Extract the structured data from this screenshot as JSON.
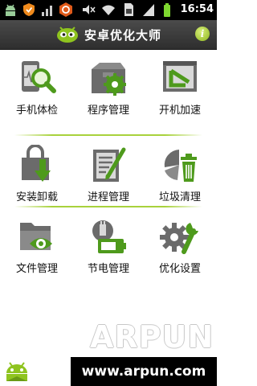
{
  "status": {
    "time": "16:54",
    "icons": [
      "android-debug-icon",
      "shield-icon",
      "signal-icon",
      "hexagon-app-icon",
      "mute-icon",
      "wifi-icon",
      "sim-icon",
      "cell-signal-icon",
      "battery-icon"
    ]
  },
  "header": {
    "title": "安卓优化大师",
    "info_label": "i"
  },
  "menu": {
    "items": [
      {
        "label": "手机体检",
        "icon": "phone-checkup-icon"
      },
      {
        "label": "程序管理",
        "icon": "app-manager-icon"
      },
      {
        "label": "开机加速",
        "icon": "boot-speed-icon"
      },
      {
        "label": "安装卸载",
        "icon": "install-uninstall-icon"
      },
      {
        "label": "进程管理",
        "icon": "process-manager-icon"
      },
      {
        "label": "垃圾清理",
        "icon": "junk-clean-icon"
      },
      {
        "label": "文件管理",
        "icon": "file-manager-icon"
      },
      {
        "label": "节电管理",
        "icon": "power-saving-icon"
      },
      {
        "label": "优化设置",
        "icon": "settings-icon"
      }
    ]
  },
  "watermark": {
    "text": "ARPUN",
    "url": "www.arpun.com"
  },
  "colors": {
    "icon_gray": "#6b6b6b",
    "accent_green": "#4e9a1c",
    "separator": "#a8d23c",
    "titlebar": "#3a3a3a"
  }
}
